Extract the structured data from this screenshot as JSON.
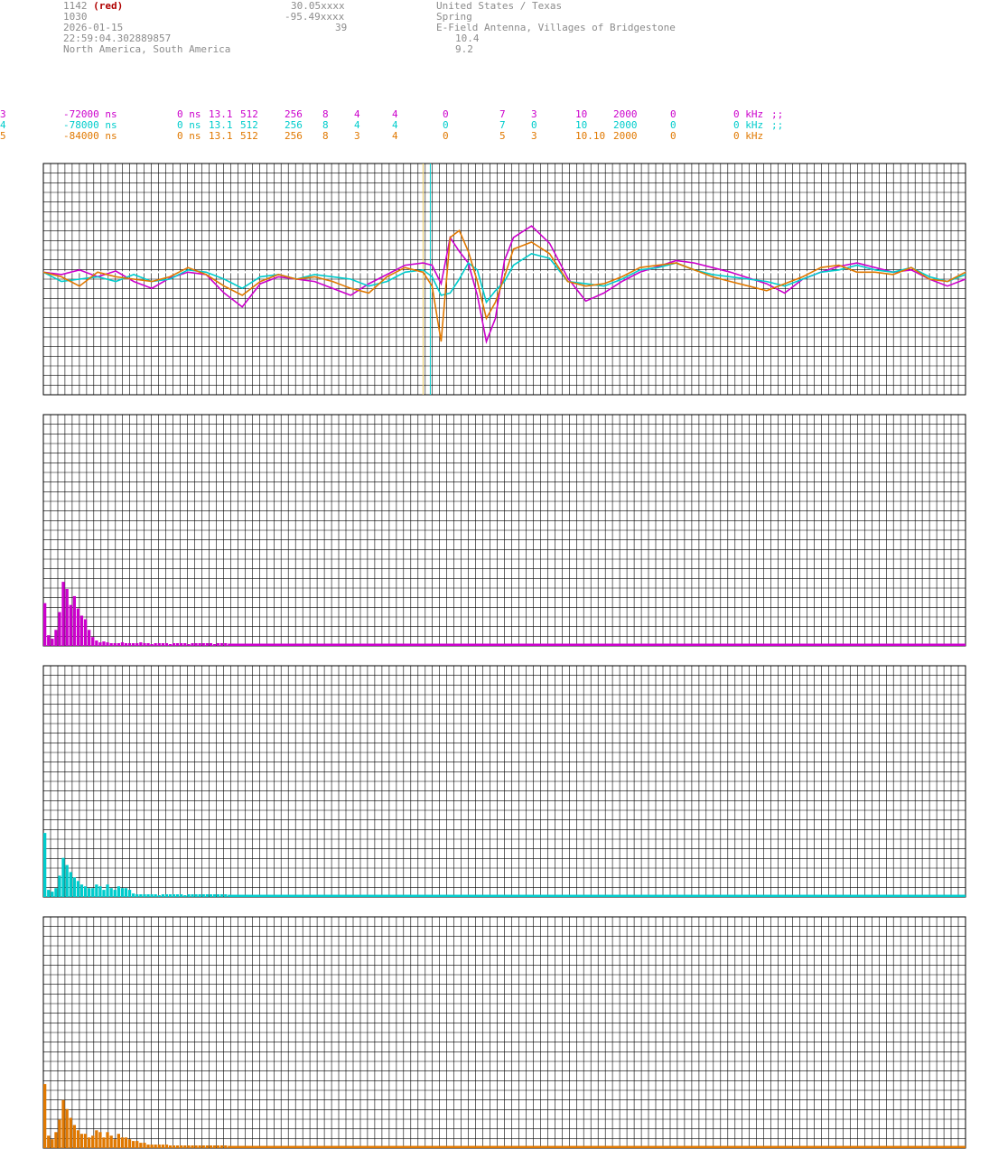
{
  "header": {
    "col1": [
      "1142",
      "1030",
      "2026-01-15",
      "22:59:04.302889857",
      "North America, South America"
    ],
    "col1_suffix": "(red)",
    "col2": [
      "30.05xxxx",
      "-95.49xxxx",
      "39"
    ],
    "col3": [
      "United States / Texas",
      "Spring",
      "E-Field Antenna, Villages of Bridgestone",
      "10.4",
      "9.2"
    ]
  },
  "rows": [
    {
      "id": "3",
      "offset": "-72000 ns",
      "a": "0 ns",
      "b": "13.1",
      "c": "512",
      "d": "256",
      "e": "8",
      "f": "4",
      "g": "4",
      "h": "0",
      "i": "7",
      "j": "3",
      "k": "10",
      "l": "2000",
      "m": "0",
      "n": "0 kHz",
      "tail": ";;",
      "color": "#cc00cc"
    },
    {
      "id": "4",
      "offset": "-78000 ns",
      "a": "0 ns",
      "b": "13.1",
      "c": "512",
      "d": "256",
      "e": "8",
      "f": "4",
      "g": "4",
      "h": "0",
      "i": "7",
      "j": "0",
      "k": "10",
      "l": "2000",
      "m": "0",
      "n": "0 kHz",
      "tail": ";;",
      "color": "#00cccc"
    },
    {
      "id": "5",
      "offset": "-84000 ns",
      "a": "0 ns",
      "b": "13.1",
      "c": "512",
      "d": "256",
      "e": "8",
      "f": "3",
      "g": "4",
      "h": "0",
      "i": "5",
      "j": "3",
      "k": "10.10",
      "l": "2000",
      "m": "0",
      "n": "0 kHz",
      "tail": "",
      "color": "#e07800"
    }
  ],
  "colors": {
    "magenta": "#cc00cc",
    "cyan": "#00cccc",
    "orange": "#e07800",
    "grid": "#000000"
  },
  "chart_data": [
    {
      "type": "line",
      "x": [
        0,
        20,
        40,
        60,
        80,
        100,
        120,
        140,
        160,
        180,
        200,
        220,
        240,
        260,
        280,
        300,
        320,
        340,
        360,
        380,
        400,
        420,
        430,
        440,
        450,
        460,
        470,
        480,
        490,
        500,
        510,
        520,
        540,
        560,
        580,
        600,
        620,
        640,
        660,
        680,
        700,
        720,
        740,
        760,
        780,
        800,
        820,
        840,
        860,
        880,
        900,
        920,
        940,
        960,
        980,
        1000,
        1020
      ],
      "series": [
        {
          "color": "#cc00cc",
          "values": [
            0,
            -2,
            2,
            -4,
            1,
            -8,
            -14,
            -5,
            0,
            -2,
            -18,
            -30,
            -10,
            -4,
            -6,
            -8,
            -14,
            -20,
            -10,
            -2,
            6,
            8,
            6,
            -10,
            30,
            18,
            8,
            -20,
            -60,
            -40,
            10,
            30,
            40,
            25,
            -5,
            -25,
            -18,
            -8,
            0,
            5,
            10,
            8,
            4,
            0,
            -5,
            -10,
            -18,
            -6,
            0,
            5,
            8,
            4,
            0,
            2,
            -6,
            -12,
            -6
          ]
        },
        {
          "color": "#00cccc",
          "values": [
            0,
            -8,
            -6,
            -4,
            -8,
            -2,
            -8,
            -6,
            2,
            0,
            -6,
            -14,
            -4,
            -2,
            -6,
            -2,
            -4,
            -6,
            -12,
            -8,
            0,
            2,
            -4,
            -20,
            -18,
            -6,
            8,
            2,
            -26,
            -16,
            -8,
            6,
            16,
            12,
            -8,
            -10,
            -12,
            -6,
            2,
            4,
            8,
            2,
            -2,
            -4,
            -6,
            -8,
            -12,
            -6,
            0,
            2,
            6,
            2,
            0,
            4,
            -4,
            -8,
            -2
          ]
        },
        {
          "color": "#e07800",
          "values": [
            0,
            -4,
            -12,
            0,
            -4,
            -6,
            -8,
            -4,
            4,
            -2,
            -12,
            -20,
            -8,
            -2,
            -6,
            -4,
            -8,
            -14,
            -18,
            -4,
            4,
            0,
            -12,
            -60,
            30,
            36,
            18,
            -8,
            -40,
            -26,
            -4,
            20,
            26,
            16,
            -8,
            -12,
            -10,
            -4,
            4,
            6,
            8,
            2,
            -4,
            -8,
            -12,
            -16,
            -10,
            -4,
            4,
            6,
            0,
            0,
            -2,
            4,
            -6,
            -8,
            0
          ]
        }
      ],
      "ylim": [
        -100,
        100
      ]
    },
    {
      "type": "bar",
      "values": [
        48,
        12,
        8,
        18,
        38,
        72,
        64,
        46,
        56,
        42,
        34,
        30,
        18,
        10,
        6,
        4,
        5,
        4,
        3,
        3,
        3,
        4,
        3,
        3,
        3,
        3,
        4,
        3,
        3,
        2,
        3,
        3,
        3,
        3,
        2,
        3,
        3,
        3,
        3,
        2,
        3,
        3,
        3,
        3,
        3,
        3,
        2,
        3,
        3,
        3
      ],
      "color": "#cc00cc",
      "ylim": [
        0,
        260
      ]
    },
    {
      "type": "bar",
      "values": [
        72,
        8,
        6,
        10,
        24,
        44,
        36,
        28,
        22,
        18,
        14,
        12,
        10,
        10,
        14,
        12,
        8,
        14,
        10,
        8,
        12,
        10,
        10,
        8,
        4,
        3,
        3,
        3,
        3,
        3,
        3,
        2,
        3,
        3,
        3,
        3,
        3,
        3,
        2,
        3,
        3,
        3,
        3,
        3,
        3,
        3,
        3,
        3,
        3,
        3
      ],
      "color": "#00cccc",
      "ylim": [
        0,
        260
      ]
    },
    {
      "type": "bar",
      "values": [
        72,
        14,
        10,
        18,
        32,
        54,
        44,
        34,
        26,
        20,
        16,
        16,
        12,
        14,
        20,
        18,
        12,
        18,
        14,
        10,
        16,
        12,
        12,
        10,
        8,
        8,
        6,
        6,
        4,
        4,
        4,
        4,
        4,
        4,
        3,
        3,
        3,
        3,
        3,
        3,
        3,
        3,
        3,
        3,
        3,
        3,
        3,
        3,
        3,
        3
      ],
      "color": "#e07800",
      "ylim": [
        0,
        260
      ]
    }
  ]
}
